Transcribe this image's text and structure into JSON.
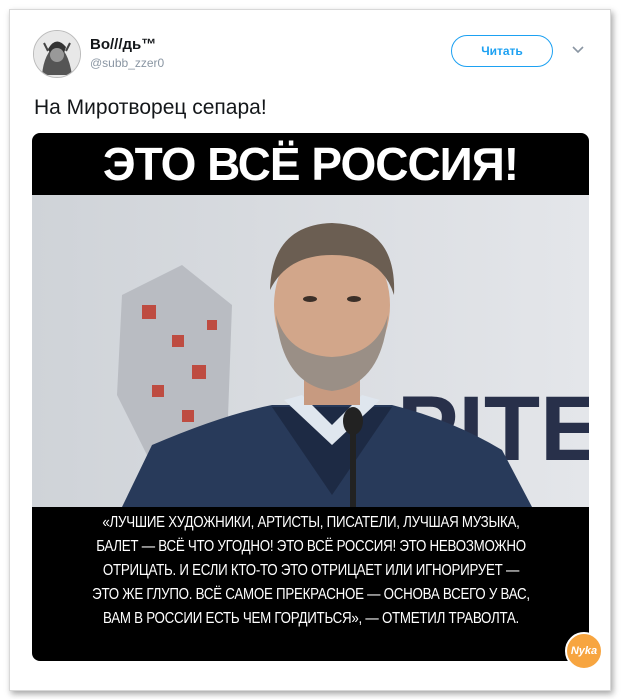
{
  "tweet": {
    "display_name": "Во///дь™",
    "handle": "@subb_zzer0",
    "follow_label": "Читать",
    "text": "На Миротворец сепара!"
  },
  "media": {
    "headline": "ЭТО ВСЁ РОССИЯ!",
    "background_sign": "PITE",
    "quote_lines": [
      "«ЛУЧШИЕ ХУДОЖНИКИ, АРТИСТЫ, ПИСАТЕЛИ, ЛУЧШАЯ МУЗЫКА,",
      "БАЛЕТ — ВСЁ ЧТО УГОДНО! ЭТО ВСЁ РОССИЯ! ЭТО НЕВОЗМОЖНО",
      "ОТРИЦАТЬ. И ЕСЛИ КТО-ТО ЭТО ОТРИЦАЕТ ИЛИ ИГНОРИРУЕТ —",
      "ЭТО ЖЕ ГЛУПО. ВСЁ САМОЕ ПРЕКРАСНОЕ — ОСНОВА ВСЕГО У ВАС,",
      "ВАМ В РОССИИ ЕСТЬ ЧЕМ ГОРДИТЬСЯ», — ОТМЕТИЛ ТРАВОЛТА."
    ],
    "watermark": "Nyka"
  },
  "colors": {
    "accent": "#1da1f2",
    "text": "#14171a",
    "muted": "#8a96a3"
  },
  "icons": {
    "more": "chevron-down-icon",
    "avatar": "avatar"
  }
}
